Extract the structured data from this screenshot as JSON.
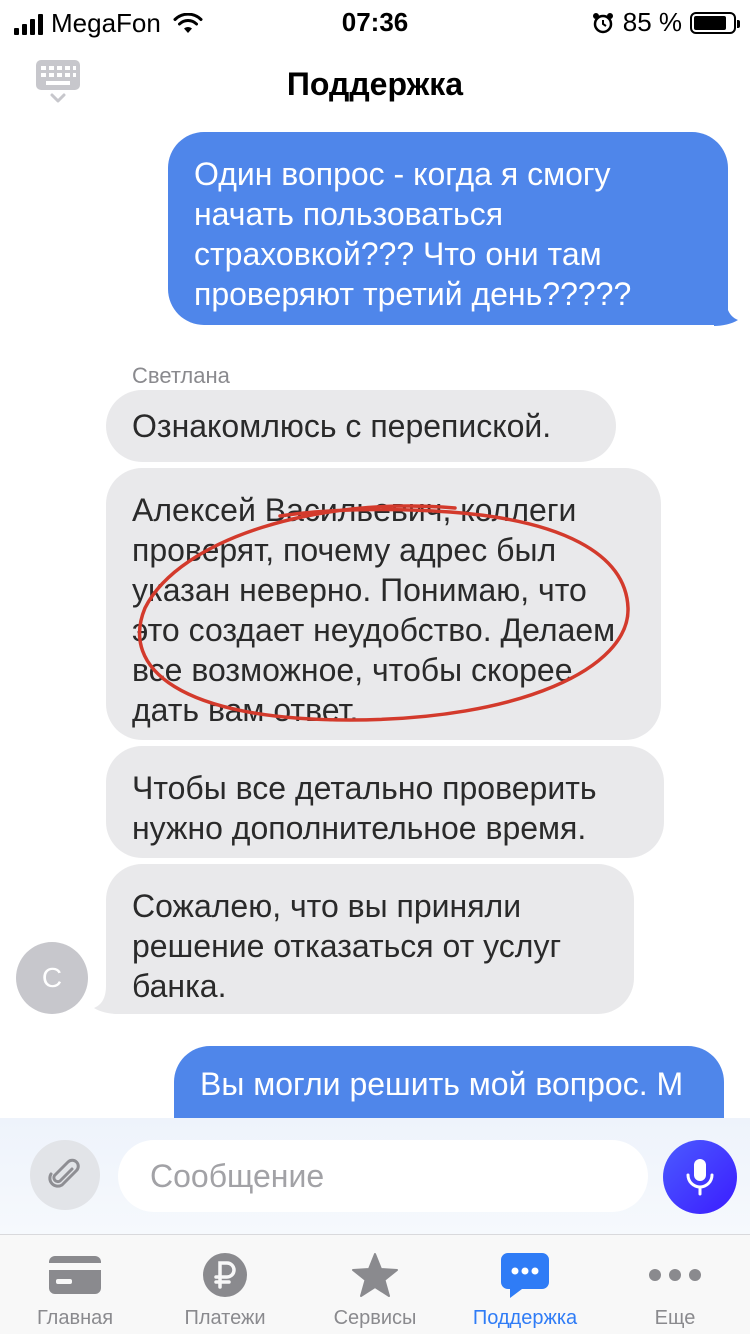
{
  "status_bar": {
    "carrier": "MegaFon",
    "time": "07:36",
    "battery": "85 %",
    "battery_level": 0.85
  },
  "header": {
    "title": "Поддержка",
    "left_icon": "keyboard-icon"
  },
  "messages": [
    {
      "direction": "outgoing",
      "text": "Один вопрос - когда я смогу начать пользоваться страховкой??? Что они там проверяют третий день?????"
    },
    {
      "direction": "incoming",
      "sender": "Светлана",
      "text": "Ознакомлюсь с перепиской."
    },
    {
      "direction": "incoming",
      "text": "Алексей Васильевич, коллеги проверят, почему адрес был указан неверно. Понимаю, что это создает неудобство. Делаем все возможное, чтобы скорее дать вам ответ."
    },
    {
      "direction": "incoming",
      "text": "Чтобы все детально проверить нужно дополнительное время."
    },
    {
      "direction": "incoming",
      "text": "Сожалею, что вы приняли решение отказаться от услуг банка."
    },
    {
      "direction": "outgoing",
      "text": "Вы могли решить мой вопрос. М"
    }
  ],
  "avatar": {
    "initial": "С"
  },
  "annotation": {
    "color": "#d33a2c"
  },
  "input": {
    "placeholder": "Сообщение",
    "value": ""
  },
  "tabs": [
    {
      "label": "Главная",
      "icon": "card-icon",
      "active": false
    },
    {
      "label": "Платежи",
      "icon": "ruble-icon",
      "active": false
    },
    {
      "label": "Сервисы",
      "icon": "star-icon",
      "active": false
    },
    {
      "label": "Поддержка",
      "icon": "chat-icon",
      "active": true
    },
    {
      "label": "Еще",
      "icon": "more-icon",
      "active": false
    }
  ],
  "colors": {
    "outgoing_bubble": "#4f86ea",
    "incoming_bubble": "#e9e9eb",
    "active_tab": "#2f7cf6",
    "mic_button": "#3b1cff"
  }
}
